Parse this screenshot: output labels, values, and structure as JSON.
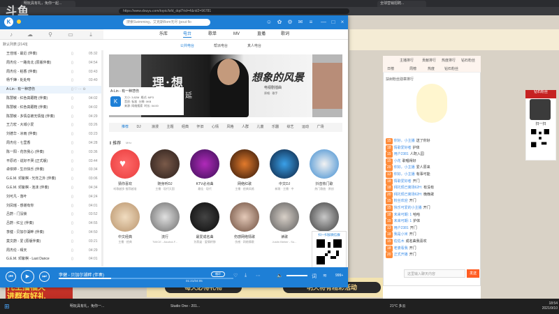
{
  "browser": {
    "logo": "斗鱼",
    "tabs": [
      "明玩具有礼，免你一起...",
      "全球营销招聘..."
    ],
    "address": "https://www.douyu.com/topic/lsfd_dqd?rid=4&rid2=96781"
  },
  "player": {
    "search_placeholder": "搜索Swimming，艾克斯Bom无尽 (pout flo",
    "top_icons": [
      "person-icon",
      "skin-icon",
      "settings-icon",
      "mail-icon",
      "menu-icon"
    ],
    "nav": [
      "乐库",
      "电台",
      "歌单",
      "MV",
      "直播",
      "歌词"
    ],
    "active_nav": 1,
    "subnav": [
      "公共电台",
      "帮派电台",
      "真人电台"
    ],
    "playlist_header": "默认列表 [2143]",
    "songs": [
      {
        "title": "王佳瑶 - 最近 (伴奏)",
        "dur": "05:32"
      },
      {
        "title": "周杰伦 - 一路向北 (原版伴奏)",
        "dur": "04:54"
      },
      {
        "title": "周杰伦 - 稻香 (伴奏)",
        "dur": "03:43"
      },
      {
        "title": "杨千嬅 - 处处吻",
        "dur": "03:40"
      },
      {
        "title": "A-Lin - 有一种悲伤",
        "dur": "",
        "current": true
      },
      {
        "title": "陈慧敏 - 红色高跟鞋 (伴奏)",
        "dur": "04:02"
      },
      {
        "title": "陈慧敏 - 红色高跟鞋 (伴奏)",
        "dur": "04:02"
      },
      {
        "title": "陈慧敏 - 多情总被无情恼 (伴奏)",
        "dur": "04:29"
      },
      {
        "title": "王力宏 - 大城小爱",
        "dur": "03:26"
      },
      {
        "title": "刘德华 - 冰雨 (伴奏)",
        "dur": "03:23"
      },
      {
        "title": "周杰伦 - 七里香",
        "dur": "04:28"
      },
      {
        "title": "陈一阳 - 花伤我心 (伴奏)",
        "dur": "03:36"
      },
      {
        "title": "平原坊 - 说好不哭 (正式版)",
        "dur": "03:44"
      },
      {
        "title": "卓依婷 - 生日快乐 (伴奏)",
        "dur": "03:34"
      },
      {
        "title": "G.E.M. 邓紫棋 - 光年之外 (伴奏)",
        "dur": "03:06"
      },
      {
        "title": "G.E.M. 邓紫棋 - 泡沫 (伴奏)",
        "dur": "04:34"
      },
      {
        "title": "刘可凡 - 落叶",
        "dur": "04:24"
      },
      {
        "title": "刘凤瑶 - 感谢有你",
        "dur": "04:01"
      },
      {
        "title": "吕蔚 - 门没锁",
        "dur": "03:52"
      },
      {
        "title": "吕蔚 - 红尘 (伴奏)",
        "dur": "04:55"
      },
      {
        "title": "李健 - 贝加尔湖畔 (伴奏)",
        "dur": "04:50"
      },
      {
        "title": "莫文蔚 - 爱 (原版伴奏)",
        "dur": "03:21"
      },
      {
        "title": "周杰伦 - 晴天",
        "dur": "04:29"
      },
      {
        "title": "G.E.M. 邓紫棋 - Last Dance",
        "dur": "04:01"
      }
    ],
    "banner": {
      "title_left": "理·想",
      "title_right": "想象的风景",
      "subtitle": "电视剧插曲",
      "sub2": "原唱 · 歌手",
      "song": "A-Lin - 有一种悲伤",
      "info1": "大小: 3.82M",
      "info2": "格式: MP3",
      "info3": "音质: 标准",
      "info4": "时长: 04:00",
      "info5": "分辨: 0KB",
      "info6": "来源: 网络搜索",
      "side_text": "延"
    },
    "categories": [
      "推荐",
      "DJ",
      "浪漫",
      "主题",
      "经典",
      "怀旧",
      "心情",
      "风格",
      "人群",
      "儿童",
      "乐器",
      "综艺",
      "运动",
      "广场"
    ],
    "section_title": "推荐",
    "section_badge": "MHz",
    "stations": [
      {
        "name": "猜你喜欢",
        "sub": "听歌越多 推荐越准"
      },
      {
        "name": "随身听DJ",
        "sub": "主播 · 现代天国"
      },
      {
        "name": "KTV必点曲",
        "sub": "最佳 · 现代"
      },
      {
        "name": "网络红歌",
        "sub": "主播 · 经典风格"
      },
      {
        "name": "中文DJ",
        "sub": "新歌 · 主播 · 中"
      },
      {
        "name": "抖音热门歌",
        "sub": "热门歌曲 · 原创"
      },
      {
        "name": "中文经典",
        "sub": "主播 · 经典"
      },
      {
        "name": "流行",
        "sub": "TWICE - Alcohol-F..."
      },
      {
        "name": "最爱成名曲",
        "sub": "孙燕姿 · 爱情转移"
      },
      {
        "name": "伤感网络情歌",
        "sub": "伤感 · 网络情歌"
      },
      {
        "name": "读歌",
        "sub": "Justin Bieber - So..."
      },
      {
        "name": "周杰伦",
        "sub": "周杰伦 · 精选"
      }
    ],
    "qr_text": "扫一扫加微信群",
    "nowplaying": "李健 - 贝加尔湖畔 (伴奏)",
    "progress": 0.3,
    "time": "01:21/04:05",
    "play_mode": "循环",
    "count": "999+"
  },
  "douyu": {
    "chat_tabs": [
      "主播排行",
      "贡献排行",
      "热度排行",
      "钻石粉丝"
    ],
    "chat_tabs2": [
      "日榜",
      "周榜",
      "热度",
      "钻石粉丝"
    ],
    "chat_header": "扶树粉丝勋章排行",
    "chat_rows": [
      {
        "lvl": "15",
        "name": "你好，小主播",
        "msg": "送了你好"
      },
      {
        "lvl": "18",
        "name": "情歌爱好者",
        "msg": "护体"
      },
      {
        "lvl": "15",
        "name": "用户2381",
        "msg": "人既入园"
      },
      {
        "lvl": "15",
        "name": "小花",
        "msg": "歌唱得好"
      },
      {
        "lvl": "20",
        "name": "你好，小主播",
        "msg": "爱人原来"
      },
      {
        "lvl": "13",
        "name": "你好，小主播",
        "msg": "有事可能"
      },
      {
        "lvl": "18",
        "name": "情歌爱好者",
        "msg": "开门"
      },
      {
        "lvl": "18",
        "name": "拜托现已离场62H:",
        "msg": "有没有"
      },
      {
        "lvl": "20",
        "name": "拜托现已离场62H:",
        "msg": "晚晚歌"
      },
      {
        "lvl": "15",
        "name": "粉丝欢迎",
        "msg": "开门"
      },
      {
        "lvl": "15",
        "name": "快乐可爱的小主播",
        "msg": "开门"
      },
      {
        "lvl": "18",
        "name": "未来可期: 1",
        "msg": "哈哈"
      },
      {
        "lvl": "15",
        "name": "未来可期: 1",
        "msg": "护体"
      },
      {
        "lvl": "13",
        "name": "用户2381",
        "msg": "开门"
      },
      {
        "lvl": "18",
        "name": "我是小米",
        "msg": "开门"
      },
      {
        "lvl": "15",
        "name": "佐佐木",
        "msg": "成名曲我喜欢"
      },
      {
        "lvl": "18",
        "name": "老婆看我",
        "msg": "开门"
      },
      {
        "lvl": "20",
        "name": "正式开播",
        "msg": "开门"
      }
    ],
    "chat_input_placeholder": "这里输入聊天内容",
    "send_label": "发送",
    "banner_left": "周星推荐",
    "banner_mid": "每天必得礼物",
    "banner_right": "明天将有精彩活动",
    "gift_left_1": "托主播福天",
    "gift_left_2": "进群有好礼",
    "right_heading": "钻石粉丝",
    "right_card_name": "扫一扫"
  },
  "taskbar": {
    "items": [
      "明玩具有礼，免你一...",
      "Studio One - 201..."
    ],
    "weather": "21°C 多云",
    "time": "18:54",
    "date": "2021/9/10"
  },
  "colors": {
    "accent": "#1e7fd6",
    "douyu_orange": "#ff5d23"
  }
}
